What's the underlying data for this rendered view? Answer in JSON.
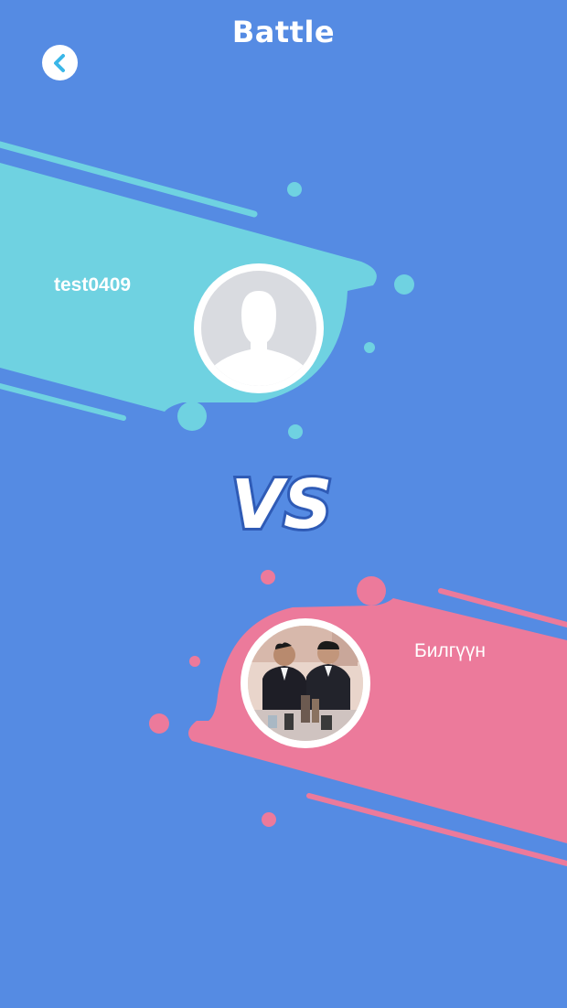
{
  "header": {
    "title": "Battle",
    "back_icon": "chevron-left-icon"
  },
  "player1": {
    "name": "test0409",
    "avatar": "default-avatar-silhouette-icon",
    "color": "#6fd2e1"
  },
  "player2": {
    "name": "Билгүүн",
    "avatar": "user-photo",
    "color": "#ec7a9b"
  },
  "versus": {
    "label": "VS"
  },
  "colors": {
    "background": "#558be3",
    "accent": "#3ab7e8"
  }
}
